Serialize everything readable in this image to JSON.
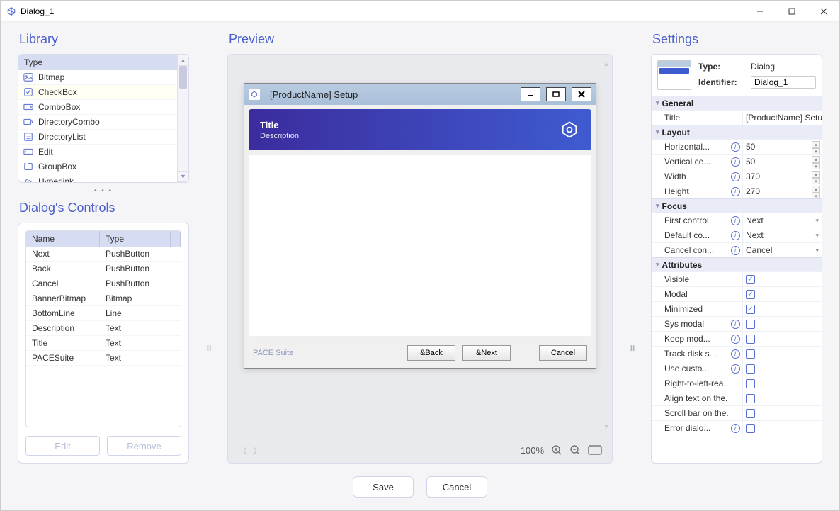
{
  "window": {
    "title": "Dialog_1"
  },
  "library": {
    "title": "Library",
    "header": "Type",
    "items": [
      {
        "name": "Bitmap",
        "icon": "bitmap"
      },
      {
        "name": "CheckBox",
        "icon": "checkbox"
      },
      {
        "name": "ComboBox",
        "icon": "combobox"
      },
      {
        "name": "DirectoryCombo",
        "icon": "directorycombo"
      },
      {
        "name": "DirectoryList",
        "icon": "directorylist"
      },
      {
        "name": "Edit",
        "icon": "edit"
      },
      {
        "name": "GroupBox",
        "icon": "groupbox"
      },
      {
        "name": "Hyperlink",
        "icon": "hyperlink"
      }
    ]
  },
  "dialog_controls": {
    "title": "Dialog's Controls",
    "headers": {
      "name": "Name",
      "type": "Type"
    },
    "rows": [
      {
        "name": "Next",
        "type": "PushButton"
      },
      {
        "name": "Back",
        "type": "PushButton"
      },
      {
        "name": "Cancel",
        "type": "PushButton"
      },
      {
        "name": "BannerBitmap",
        "type": "Bitmap"
      },
      {
        "name": "BottomLine",
        "type": "Line"
      },
      {
        "name": "Description",
        "type": "Text"
      },
      {
        "name": "Title",
        "type": "Text"
      },
      {
        "name": "PACESuite",
        "type": "Text"
      }
    ],
    "buttons": {
      "edit": "Edit",
      "remove": "Remove"
    }
  },
  "preview": {
    "title": "Preview",
    "dialog": {
      "title": "[ProductName] Setup",
      "banner_title": "Title",
      "banner_desc": "Description",
      "brand": "PACE Suite",
      "back": "&Back",
      "next": "&Next",
      "cancel": "Cancel"
    },
    "zoom": "100%"
  },
  "settings": {
    "title": "Settings",
    "top": {
      "type_label": "Type:",
      "type_value": "Dialog",
      "identifier_label": "Identifier:",
      "identifier_value": "Dialog_1"
    },
    "sections": {
      "general": "General",
      "layout": "Layout",
      "focus": "Focus",
      "attributes": "Attributes"
    },
    "props": {
      "title_label": "Title",
      "title_value": "[ProductName] Setup",
      "horizontal": "Horizontal...",
      "horizontal_val": "50",
      "vertical": "Vertical ce...",
      "vertical_val": "50",
      "width": "Width",
      "width_val": "370",
      "height": "Height",
      "height_val": "270",
      "first_control": "First control",
      "first_control_val": "Next",
      "default_control": "Default co...",
      "default_control_val": "Next",
      "cancel_control": "Cancel con...",
      "cancel_control_val": "Cancel",
      "visible": "Visible",
      "modal": "Modal",
      "minimized": "Minimized",
      "sys_modal": "Sys modal",
      "keep_mod": "Keep mod...",
      "track_disk": "Track disk s...",
      "use_custo": "Use custo...",
      "rtl_read": "Right-to-left-rea...",
      "align_text": "Align text on the...",
      "scroll_bar": "Scroll bar on the...",
      "error_dialo": "Error dialo..."
    }
  },
  "footer": {
    "save": "Save",
    "cancel": "Cancel"
  }
}
